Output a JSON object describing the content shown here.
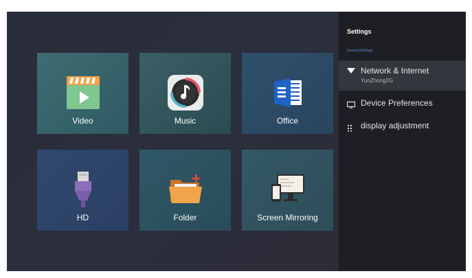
{
  "apps": {
    "video": {
      "label": "Video"
    },
    "music": {
      "label": "Music"
    },
    "office": {
      "label": "Office"
    },
    "hd": {
      "label": "HD"
    },
    "folder": {
      "label": "Folder"
    },
    "mirror": {
      "label": "Screen Mirroring"
    }
  },
  "settings": {
    "title": "Settings",
    "subtitle": "General Settings",
    "items": [
      {
        "label": "Network & Internet",
        "sub": "YunZhong2G",
        "icon": "wifi-icon"
      },
      {
        "label": "Device Preferences",
        "icon": "monitor-icon"
      },
      {
        "label": "display adjustment",
        "icon": "grid-icon"
      }
    ]
  },
  "colors": {
    "accent": "#5c8fd0",
    "panel": "#1e1f24",
    "selected": "#34363d"
  }
}
